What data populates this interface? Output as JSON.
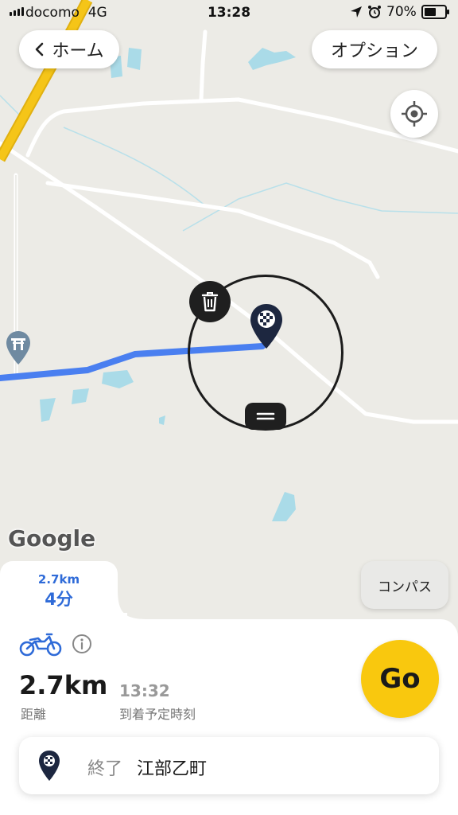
{
  "status_bar": {
    "carrier": "docomo",
    "network": "4G",
    "time": "13:28",
    "battery": "70%",
    "battery_level": 0.7
  },
  "header": {
    "home_label": "ホーム",
    "options_label": "オプション"
  },
  "map": {
    "attribution": "Google",
    "compass_label": "コンパス",
    "route_color": "#4a7ff0",
    "highway_color": "#f5c518"
  },
  "route_tab": {
    "distance": "2.7km",
    "duration": "4分"
  },
  "summary": {
    "distance": "2.7km",
    "distance_label": "距離",
    "eta": "13:32",
    "eta_label": "到着予定時刻",
    "go_label": "Go",
    "accent_color": "#f9c80e",
    "link_color": "#2f6bd8"
  },
  "destination": {
    "label": "終了",
    "place": "江部乙町"
  },
  "icons": [
    "back-chevron-icon",
    "locate-icon",
    "trash-icon",
    "menu-handle-icon",
    "destination-pin-icon",
    "shrine-icon",
    "motorcycle-icon",
    "info-icon",
    "location-arrow-icon",
    "alarm-icon",
    "battery-icon",
    "signal-icon"
  ]
}
